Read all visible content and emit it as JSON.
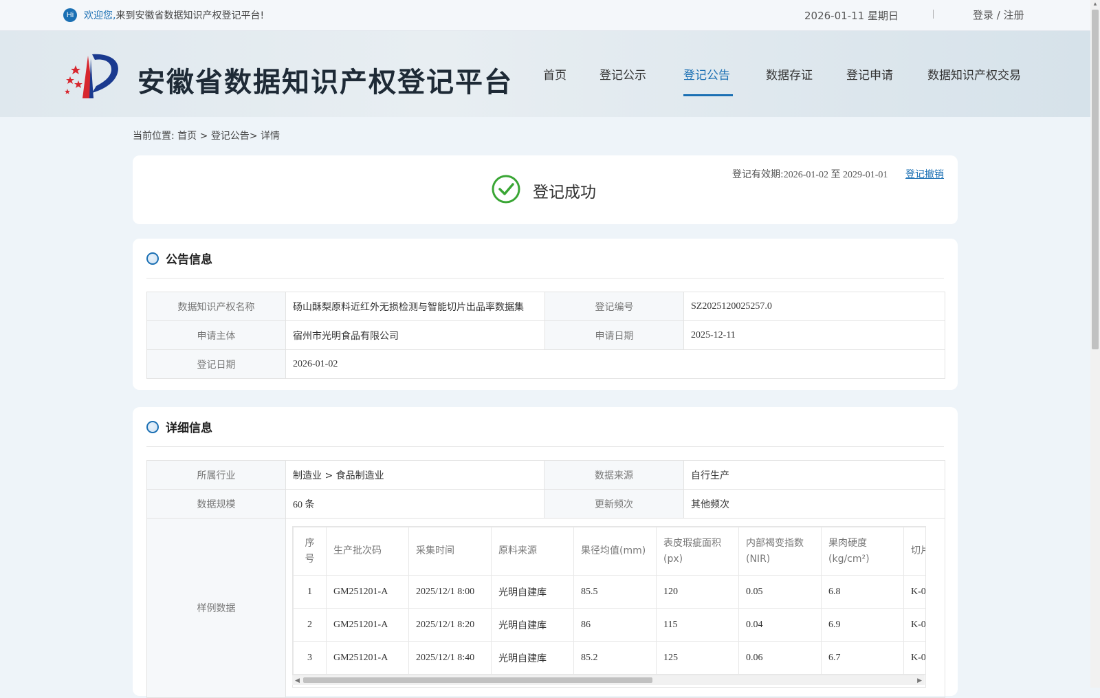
{
  "topbar": {
    "hi_badge": "Hi",
    "welcome_bold": "欢迎您,",
    "welcome_rest": "来到安徽省数据知识产权登记平台!",
    "date": "2026-01-11 星期日",
    "separator": "|",
    "login_label": "登录 / 注册"
  },
  "header": {
    "site_title": "安徽省数据知识产权登记平台",
    "nav": [
      {
        "label": "首页",
        "active": false
      },
      {
        "label": "登记公示",
        "active": false
      },
      {
        "label": "登记公告",
        "active": true
      },
      {
        "label": "数据存证",
        "active": false
      },
      {
        "label": "登记申请",
        "active": false
      },
      {
        "label": "数据知识产权交易",
        "active": false
      }
    ]
  },
  "breadcrumb": {
    "prefix": "当前位置:",
    "home": "首页",
    "arrow1": " > ",
    "section": "登记公告",
    "arrow2": "> ",
    "current": "详情"
  },
  "status": {
    "text": "登记成功",
    "validity_label": "登记有效期:",
    "validity_from": "2026-01-02",
    "validity_to_word": "至",
    "validity_to": "2029-01-01",
    "revoke_label": "登记撤销"
  },
  "announcement": {
    "title": "公告信息",
    "name_label": "数据知识产权名称",
    "name_value": "砀山酥梨原料近红外无损检测与智能切片出品率数据集",
    "reg_no_label": "登记编号",
    "reg_no_value": "SZ2025120025257.0",
    "applicant_label": "申请主体",
    "applicant_value": "宿州市光明食品有限公司",
    "apply_date_label": "申请日期",
    "apply_date_value": "2025-12-11",
    "reg_date_label": "登记日期",
    "reg_date_value": "2026-01-02"
  },
  "details": {
    "title": "详细信息",
    "industry_label": "所属行业",
    "industry_value": "制造业 > 食品制造业",
    "source_label": "数据来源",
    "source_value": "自行生产",
    "scale_label": "数据规模",
    "scale_value": "60 条",
    "freq_label": "更新频次",
    "freq_value": "其他频次",
    "sample_label": "样例数据",
    "sample_columns": [
      "序号",
      "生产批次码",
      "采集时间",
      "原料来源",
      "果径均值(mm)",
      "表皮瑕疵面积(px)",
      "内部褐变指数(NIR)",
      "果肉硬度(kg/cm²)",
      "切片"
    ],
    "sample_rows": [
      [
        "1",
        "GM251201-A",
        "2025/12/1 8:00",
        "光明自建库",
        "85.5",
        "120",
        "0.05",
        "6.8",
        "K-0"
      ],
      [
        "2",
        "GM251201-A",
        "2025/12/1 8:20",
        "光明自建库",
        "86",
        "115",
        "0.04",
        "6.9",
        "K-0"
      ],
      [
        "3",
        "GM251201-A",
        "2025/12/1 8:40",
        "光明自建库",
        "85.2",
        "125",
        "0.06",
        "6.7",
        "K-0"
      ]
    ]
  },
  "colors": {
    "accent": "#1a6fb3",
    "success": "#3aa635",
    "page_bg": "#eef4f9"
  },
  "icons": {
    "hi": "hi-badge-icon",
    "logo": "platform-logo",
    "check": "success-check-icon",
    "section": "section-bullet-icon"
  }
}
